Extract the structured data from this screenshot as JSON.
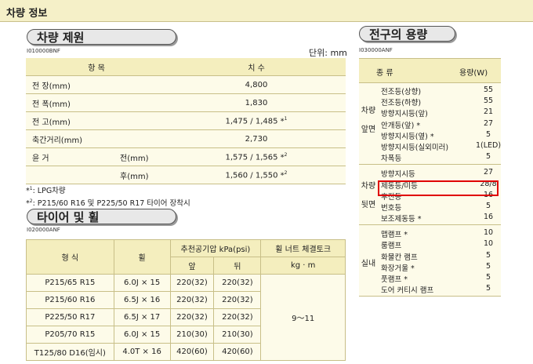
{
  "header": {
    "title": "차량 정보"
  },
  "spec": {
    "title": "차량 제원",
    "code": "I010000BNF",
    "unit": "단위: mm",
    "col_item": "항   목",
    "col_value": "치   수",
    "rows": [
      {
        "label": "전 장(mm)",
        "value": "4,800"
      },
      {
        "label": "전 폭(mm)",
        "value": "1,830"
      },
      {
        "label": "전 고(mm)",
        "value": "1,475 / 1,485 *",
        "sup": "1"
      },
      {
        "label": "축간거리(mm)",
        "value": "2,730"
      }
    ],
    "tread": {
      "label": "윤 거",
      "front": {
        "label": "전(mm)",
        "value": "1,575 / 1,565 *",
        "sup": "2"
      },
      "rear": {
        "label": "후(mm)",
        "value": "1,560 / 1,550 *",
        "sup": "2"
      }
    }
  },
  "notes": [
    {
      "mark": "*",
      "sup": "1",
      "text": ": LPG차량"
    },
    {
      "mark": "*",
      "sup": "2",
      "text": ": P215/60 R16 및 P225/50 R17 타이어 장착시"
    }
  ],
  "tire": {
    "title": "타이어 및 휠",
    "code": "I020000ANF",
    "h_type": "형   식",
    "h_wheel": "휠",
    "h_pressure": "추천공기압  kPa(psi)",
    "h_front": "앞",
    "h_rear": "뒤",
    "h_torque": "휠 너트 체결토크",
    "h_torque_unit": "kg · m",
    "torque_value": "9～11",
    "rows": [
      {
        "type": "P215/65 R15",
        "wheel": "6.0J × 15",
        "front": "220(32)",
        "rear": "220(32)"
      },
      {
        "type": "P215/60 R16",
        "wheel": "6.5J × 16",
        "front": "220(32)",
        "rear": "220(32)"
      },
      {
        "type": "P225/50 R17",
        "wheel": "6.5J × 17",
        "front": "220(32)",
        "rear": "220(32)"
      },
      {
        "type": "P205/70 R15",
        "wheel": "6.0J × 15",
        "front": "210(30)",
        "rear": "210(30)"
      },
      {
        "type": "T125/80 D16(임시)",
        "wheel": "4.0T × 16",
        "front": "420(60)",
        "rear": "420(60)"
      }
    ]
  },
  "bulbs": {
    "title": "전구의 용량",
    "code": "I030000ANF",
    "h_type": "종       류",
    "h_cap": "용량(W)",
    "groups": [
      {
        "label": "차량\n앞면",
        "items": [
          {
            "name": "전조등(상향)",
            "value": "55"
          },
          {
            "name": "전조등(하향)",
            "value": "55"
          },
          {
            "name": "방향지시등(앞)",
            "value": "21"
          },
          {
            "name": "안개등(앞) *",
            "value": "27"
          },
          {
            "name": "방향지시등(옆) *",
            "value": "5"
          },
          {
            "name": "방향지시등(실외미러)",
            "value": "1(LED)"
          },
          {
            "name": "차폭등",
            "value": "5"
          }
        ]
      },
      {
        "label": "차량\n뒷면",
        "items": [
          {
            "name": "방향지시등",
            "value": "27"
          },
          {
            "name": "제동등/미등",
            "value": "28/8"
          },
          {
            "name": "후진등",
            "value": "16"
          },
          {
            "name": "번호등",
            "value": "5"
          },
          {
            "name": "보조제동등 *",
            "value": "16"
          }
        ]
      },
      {
        "label": "실내",
        "items": [
          {
            "name": "맵램프 *",
            "value": "10"
          },
          {
            "name": "룸램프",
            "value": "10"
          },
          {
            "name": "화물칸 램프",
            "value": "5"
          },
          {
            "name": "화장거울 *",
            "value": "5"
          },
          {
            "name": "풋램프 *",
            "value": "5"
          },
          {
            "name": "도어 커티시 램프",
            "value": "5"
          }
        ]
      }
    ]
  }
}
